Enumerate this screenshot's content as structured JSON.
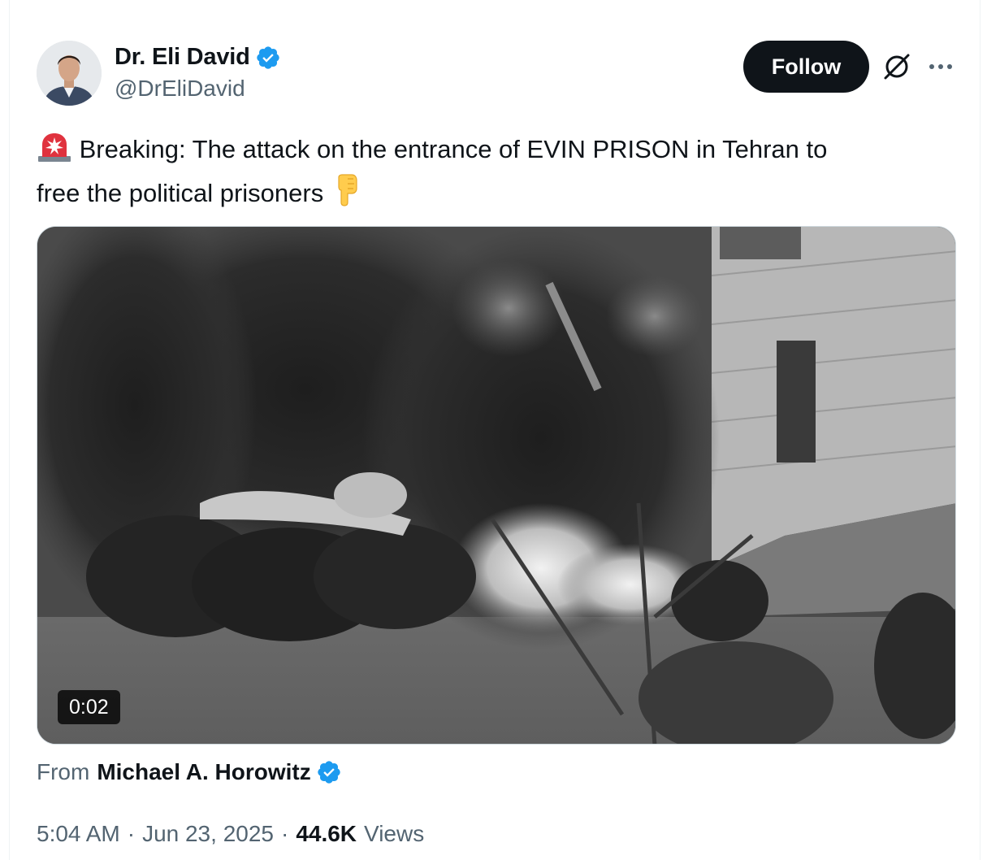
{
  "author": {
    "display_name": "Dr. Eli David",
    "handle": "@DrEliDavid",
    "verified": true
  },
  "actions": {
    "follow_label": "Follow",
    "grok_icon": "grok-icon",
    "more_icon": "more-options-icon"
  },
  "tweet": {
    "alert_emoji": "🚨",
    "text_line1": "Breaking: The attack on the entrance of EVIN PRISON in Tehran to",
    "text_line2": "free the political prisoners",
    "pointing_emoji": "👇"
  },
  "media": {
    "type": "video",
    "duration": "0:02"
  },
  "source": {
    "from_label": "From",
    "name": "Michael A. Horowitz",
    "verified": true
  },
  "meta": {
    "time": "5:04 AM",
    "separator": "·",
    "date": "Jun 23, 2025",
    "views_count": "44.6K",
    "views_label": "Views"
  },
  "colors": {
    "accent": "#1d9bf0",
    "primary_text": "#0f1419",
    "secondary_text": "#536471",
    "button_bg": "#0f1419"
  }
}
